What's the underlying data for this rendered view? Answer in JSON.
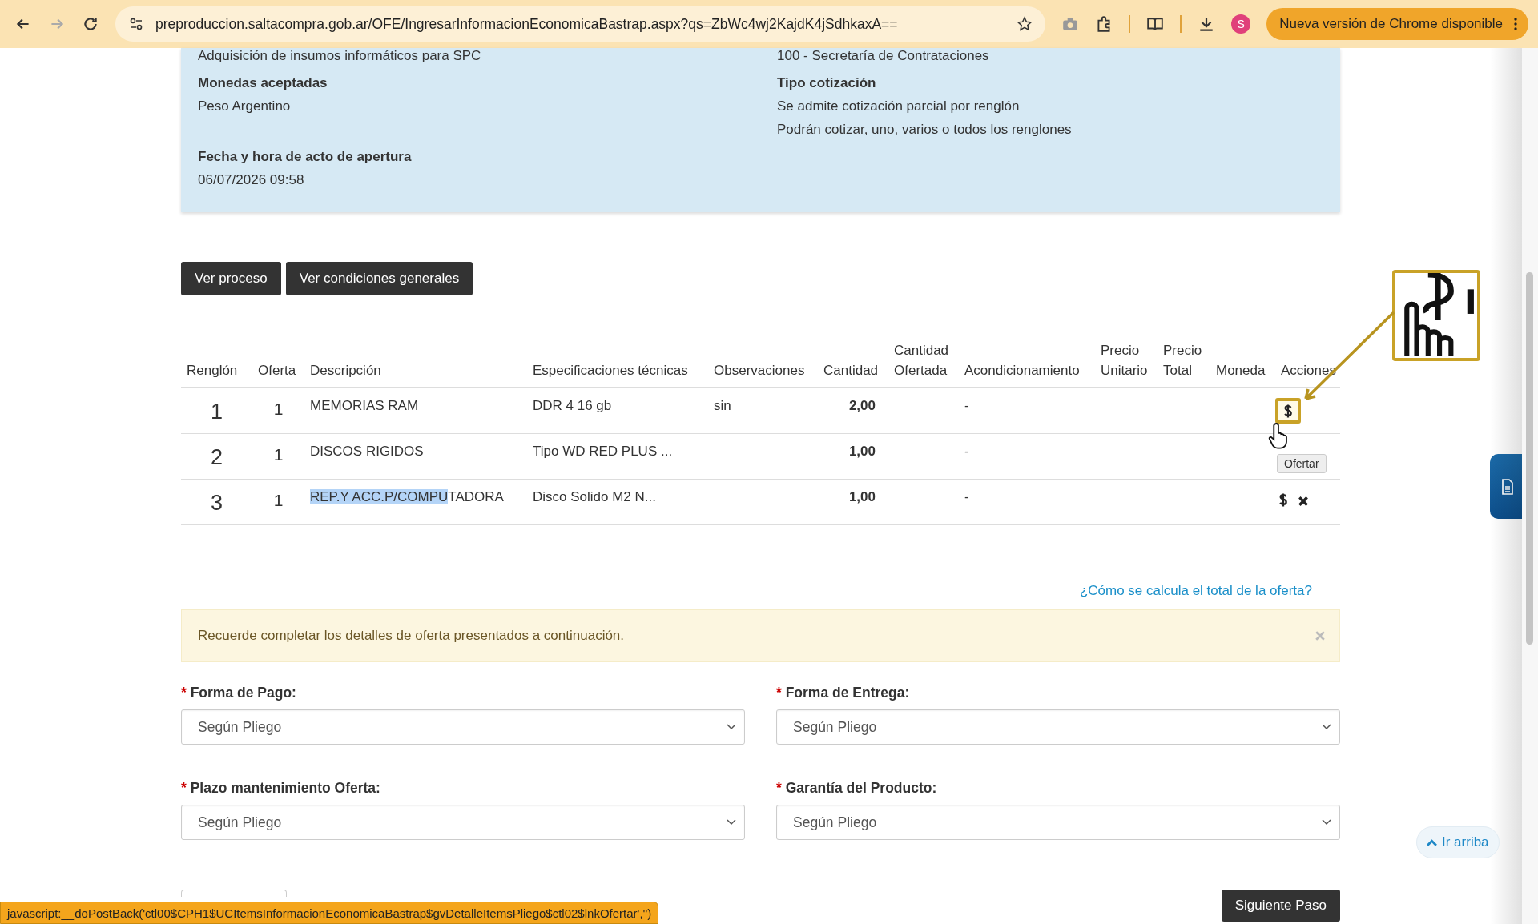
{
  "browser": {
    "url": "preproduccion.saltacompra.gob.ar/OFE/IngresarInformacionEconomicaBastrap.aspx?qs=ZbWc4wj2KajdK4jSdhkaxA==",
    "profile_initial": "S",
    "update_button": "Nueva versión de Chrome disponible"
  },
  "summary": {
    "cut_values": [
      "Adquisición de insumos informáticos para SPC",
      "100 - Secretaría de Contrataciones"
    ],
    "fields": [
      {
        "label": "Monedas aceptadas",
        "values": [
          "Peso Argentino"
        ]
      },
      {
        "label": "Tipo cotización",
        "values": [
          "Se admite cotización parcial por renglón",
          "Podrán cotizar, uno, varios o todos los renglones"
        ]
      },
      {
        "label": "Fecha y hora de acto de apertura",
        "values": [
          "06/07/2026 09:58"
        ]
      }
    ]
  },
  "buttons": [
    "Ver proceso",
    "Ver condiciones generales"
  ],
  "table": {
    "columns": [
      "Renglón",
      "Oferta",
      "Descripción",
      "Especificaciones técnicas",
      "Observaciones",
      "Cantidad",
      "Cantidad Ofertada",
      "Acondicionamiento",
      "Precio Unitario",
      "Precio Total",
      "Moneda",
      "Acciones"
    ],
    "tooltip": "Ofertar",
    "rows": [
      {
        "renglon": "1",
        "oferta": "1",
        "description_parts": [
          {
            "text": "MEMORIAS RAM",
            "selected": false
          }
        ],
        "specs": "DDR 4 16 gb",
        "observations": "sin",
        "quantity": "2,00",
        "conditioning": "-",
        "actions": [
          {
            "kind": "offer",
            "highlighted": true
          }
        ]
      },
      {
        "renglon": "2",
        "oferta": "1",
        "description_parts": [
          {
            "text": "DISCOS RIGIDOS",
            "selected": false
          }
        ],
        "specs": "Tipo WD RED PLUS ...",
        "quantity": "1,00",
        "conditioning": "-"
      },
      {
        "renglon": "3",
        "oferta": "1",
        "description_parts": [
          {
            "text": "REP.Y ACC.P/COMPU",
            "selected": true
          },
          {
            "text": "TADORA",
            "selected": false
          }
        ],
        "specs": "Disco Solido M2 N...",
        "quantity": "1,00",
        "conditioning": "-",
        "actions": [
          {
            "kind": "offer",
            "highlighted": false
          },
          {
            "kind": "remove"
          }
        ]
      }
    ]
  },
  "help_link": "¿Cómo se calcula el total de la oferta?",
  "alert": {
    "text": "Recuerde completar los detalles de oferta presentados a continuación."
  },
  "form": {
    "required_mark": "*",
    "fields": [
      {
        "label": "Forma de Pago:",
        "required": true,
        "value": "Según Pliego"
      },
      {
        "label": "Forma de Entrega:",
        "required": true,
        "value": "Según Pliego"
      },
      {
        "label": "Plazo mantenimiento Oferta:",
        "required": true,
        "value": "Según Pliego"
      },
      {
        "label": "Garantía del Producto:",
        "required": true,
        "value": "Según Pliego"
      }
    ]
  },
  "back_to_top": "Ir arriba",
  "next_button": "Siguiente Paso",
  "status_bar": "javascript:__doPostBack('ctl00$CPH1$UCItemsInformacionEconomicaBastrap$gvDetalleItemsPliego$ctl02$lnkOfertar','')"
}
